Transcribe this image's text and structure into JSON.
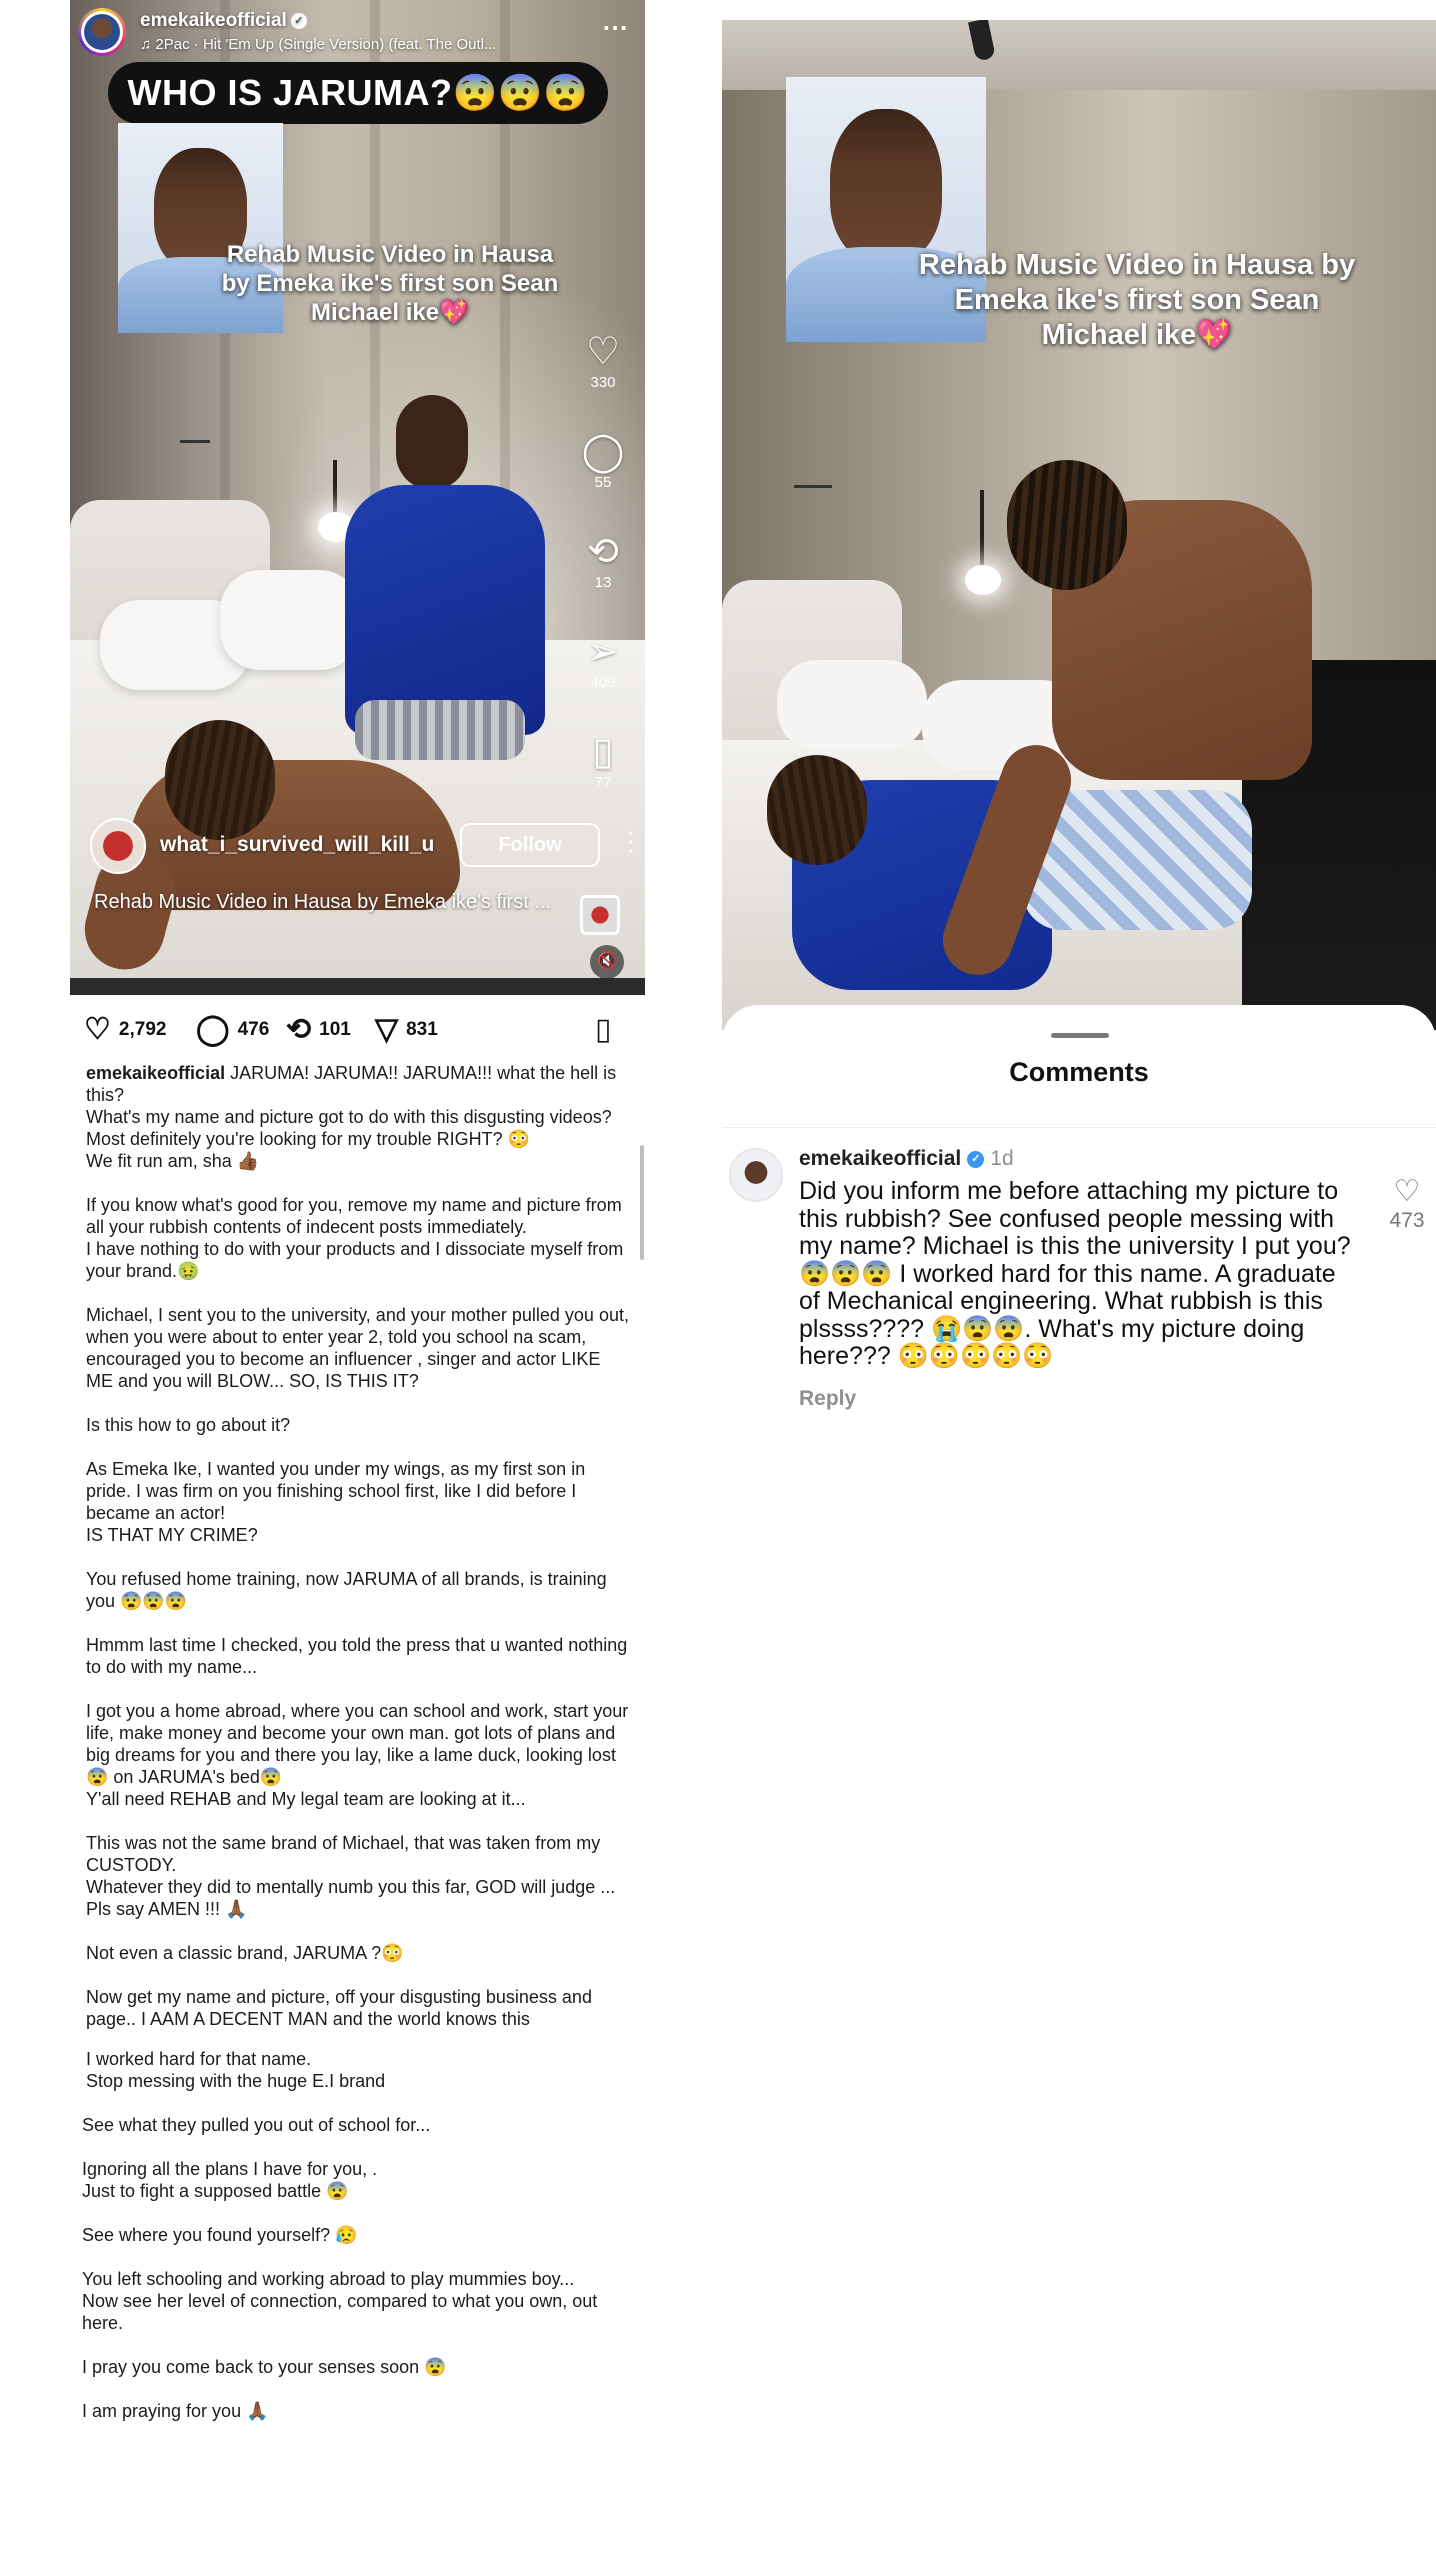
{
  "reel": {
    "username": "emekaikeofficial",
    "music": "2Pac · Hit 'Em Up (Single Version) (feat. The Outl...",
    "headline": "WHO IS JARUMA?😨😨😨",
    "overlay_text": "Rehab Music Video in Hausa by Emeka ike's first son Sean Michael ike💖",
    "likes": "330",
    "comments": "55",
    "reposts": "13",
    "shares": "409",
    "saves": "77",
    "poster": "what_i_survived_will_kill_u",
    "follow_label": "Follow",
    "caption": "Rehab Music Video in Hausa by Emeka ike's first ...",
    "icons": {
      "like": "heart-icon",
      "comment": "comment-icon",
      "repost": "repost-icon",
      "share": "send-icon",
      "save": "bookmark-icon",
      "mute": "muted-speaker-icon"
    }
  },
  "post": {
    "likes": "2,792",
    "comments": "476",
    "reposts": "101",
    "shares": "831",
    "username": "emekaikeofficial",
    "paragraphs": [
      " JARUMA! JARUMA!! JARUMA!!! what the hell is this?\n What's  my name and picture got to do with this  disgusting videos?\n Most definitely you're looking for my trouble RIGHT? 😳\nWe fit run am, sha 👍🏾",
      "If you know what's good for you, remove my name and picture from all your rubbish contents of indecent posts immediately.\n I have nothing to do with your products and I dissociate myself from your brand.🤢",
      "Michael, I sent you to the university, and your mother pulled you out, when you were about to enter year 2, told you school na scam, encouraged you to become an influencer , singer and actor LIKE ME and you will BLOW... SO,  IS THIS IT?",
      "Is this how to go about it?",
      "As Emeka Ike, I wanted you under my wings, as my first son in pride. I was firm on you finishing school first, like I did before I became an actor!\nIS THAT MY CRIME?",
      "You refused home training, now JARUMA of all brands, is training you 😨😨😨",
      "Hmmm last time I checked, you told the press that u wanted nothing to do with my name...",
      "I got you a home abroad, where you can school and work, start your life, make money and become your own man. got lots of plans and big dreams for you and there you lay,  like a lame duck, looking lost 😨 on JARUMA's bed😨\nY'all need REHAB and My legal team are looking at it...",
      "This was not the same brand of Michael, that was taken from my CUSTODY.\nWhatever they did to mentally numb you this far, GOD will judge ...\nPls say AMEN !!! 🙏🏾",
      " Not even a classic brand, JARUMA ?😳",
      "Now get my name and picture, off your disgusting business and page.. I AAM A DECENT MAN and the world knows this",
      " I worked hard for that name.\n Stop messing with the huge E.I brand",
      "See what they pulled you out of school for...",
      "Ignoring all the plans I have for you, .\nJust to fight a supposed battle 😨",
      "See where you found yourself? 😥",
      "You left schooling and working abroad to play mummies boy...\nNow see her level of connection, compared to what you own, out here.",
      "I pray you come back to your senses soon 😨",
      "I am praying for you 🙏🏾"
    ]
  },
  "comments_sheet": {
    "title": "Comments",
    "comment": {
      "username": "emekaikeofficial",
      "time": "1d",
      "text": "Did you inform me before attaching my picture to this rubbish?  See confused people messing with my name? Michael is this the university I put you? 😨😨😨 I worked hard for this name. A graduate of Mechanical engineering. What rubbish is this plssss???? 😭😨😨. What's my picture doing here??? 😳😳😳😳😳",
      "reply_label": "Reply",
      "likes": "473"
    }
  },
  "colors": {
    "follow_border": "#ffffff",
    "verified_blue": "#3897f0",
    "headline_bg": "#111111",
    "muted_text": "#8e8e8e"
  }
}
